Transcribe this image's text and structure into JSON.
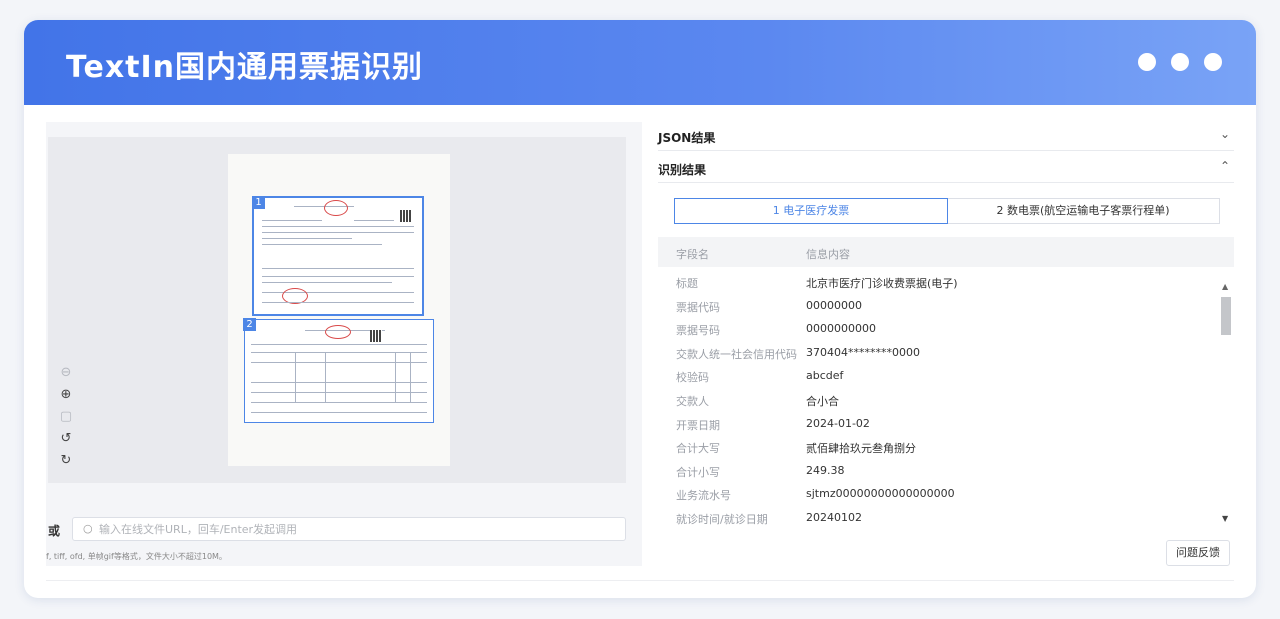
{
  "app": {
    "title": "TextIn国内通用票据识别"
  },
  "left": {
    "doc_labels": [
      "1",
      "2"
    ],
    "tools": [
      "zoom-out",
      "zoom-in",
      "fit",
      "rotate-left",
      "rotate-right"
    ],
    "url_or": "或",
    "url_placeholder": "输入在线文件URL，回车/Enter发起调用",
    "hint": "f, tiff, ofd, 单帧gif等格式，文件大小不超过10M。"
  },
  "right": {
    "json_section": {
      "label": "JSON结果",
      "chevron": "⌄"
    },
    "result_section": {
      "label": "识别结果",
      "chevron": "⌃"
    },
    "tabs": [
      {
        "label": "1 电子医疗发票",
        "active": true
      },
      {
        "label": "2 数电票(航空运输电子客票行程单)",
        "active": false
      }
    ],
    "table_header": {
      "field": "字段名",
      "value": "信息内容"
    },
    "rows": [
      {
        "k": "标题",
        "v": "北京市医疗门诊收费票据(电子)"
      },
      {
        "k": "票据代码",
        "v": "00000000"
      },
      {
        "k": "票据号码",
        "v": "0000000000"
      },
      {
        "k": "交款人统一社会信用代码",
        "v": "370404********0000"
      },
      {
        "k": "校验码",
        "v": "abcdef"
      },
      {
        "k": "交款人",
        "v": "合小合"
      },
      {
        "k": "开票日期",
        "v": "2024-01-02"
      },
      {
        "k": "合计大写",
        "v": "贰佰肆拾玖元叁角捌分"
      },
      {
        "k": "合计小写",
        "v": "249.38"
      },
      {
        "k": "业务流水号",
        "v": "sjtmz00000000000000000"
      },
      {
        "k": "就诊时间/就诊日期",
        "v": "20240102"
      }
    ],
    "feedback": "问题反馈"
  },
  "colors": {
    "accent": "#4d86e6",
    "header_start": "#4274e8",
    "header_end": "#79a3f6"
  }
}
